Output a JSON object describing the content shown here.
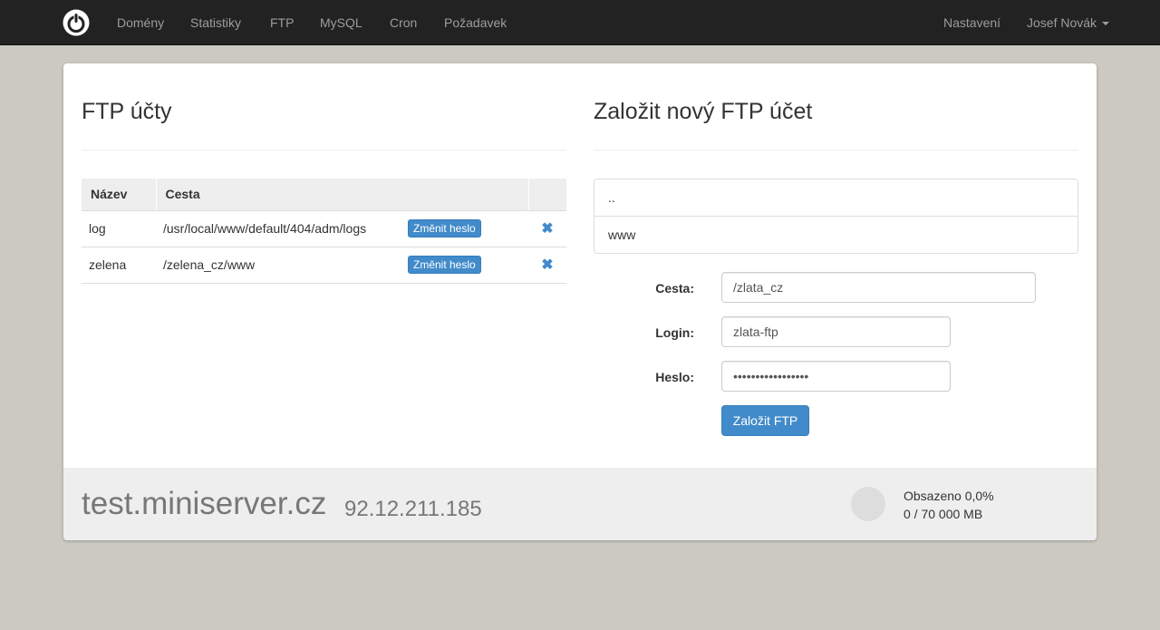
{
  "nav": {
    "items": [
      "Domény",
      "Statistiky",
      "FTP",
      "MySQL",
      "Cron",
      "Požadavek"
    ],
    "settings": "Nastavení",
    "user": "Josef Novák"
  },
  "ftp_accounts": {
    "title": "FTP účty",
    "columns": [
      "Název",
      "Cesta"
    ],
    "rows": [
      {
        "name": "log",
        "path": "/usr/local/www/default/404/adm/logs",
        "action": "Změnit heslo"
      },
      {
        "name": "zelena",
        "path": "/zelena_cz/www",
        "action": "Změnit heslo"
      }
    ]
  },
  "new_ftp": {
    "title": "Založit nový FTP účet",
    "dirs": [
      "..",
      "www"
    ],
    "path_label": "Cesta:",
    "path_value": "/zlata_cz",
    "login_label": "Login:",
    "login_value": "zlata-ftp",
    "password_label": "Heslo:",
    "password_value": "•••••••••••••••••",
    "submit": "Založit FTP"
  },
  "footer": {
    "hostname": "test.miniserver.cz",
    "ip": "92.12.211.185",
    "usage_label": "Obsazeno 0,0%",
    "usage_detail": "0 / 70 000 MB",
    "usage_fraction": 0.0
  },
  "colors": {
    "navbar": "#222222",
    "accent": "#428bca",
    "background": "#cbc9c0"
  }
}
